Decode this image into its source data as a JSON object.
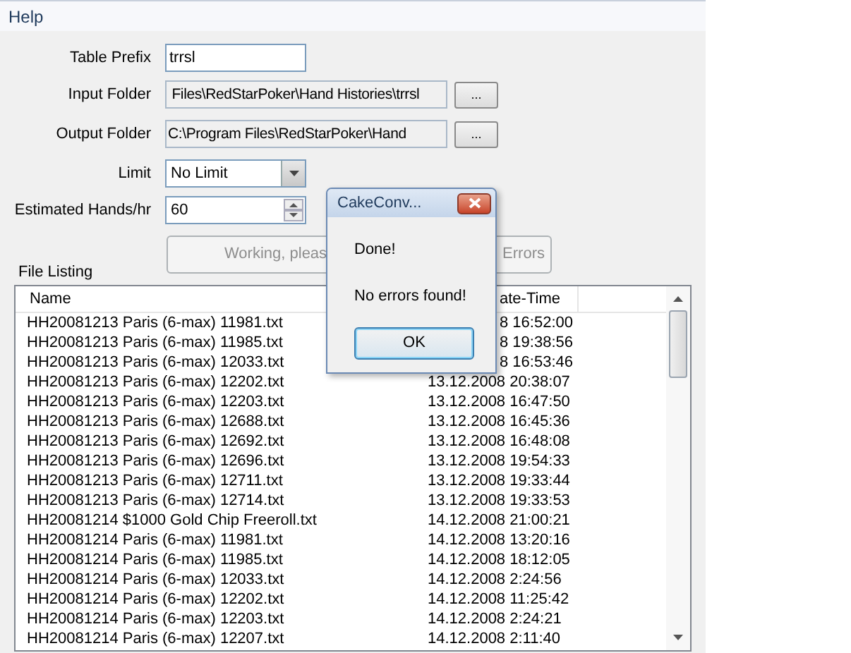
{
  "menu": [
    "Help"
  ],
  "form": {
    "table_prefix": {
      "label": "Table Prefix",
      "value": "trrsl"
    },
    "input_folder": {
      "label": "Input Folder",
      "value": " Files\\RedStarPoker\\Hand Histories\\trrsl",
      "browse": "..."
    },
    "output_folder": {
      "label": "Output Folder",
      "value": "C:\\Program Files\\RedStarPoker\\Hand",
      "browse": "..."
    },
    "limit": {
      "label": "Limit",
      "value": "No Limit"
    },
    "hands_per_hour": {
      "label": "Estimated Hands/hr",
      "value": "60"
    }
  },
  "action_button": {
    "label_left": "Working, pleas",
    "label_right": "Errors",
    "disabled": true
  },
  "file_listing": {
    "label": "File Listing",
    "columns": [
      {
        "label": "Name"
      },
      {
        "label": "ate-Time",
        "clipped": true
      }
    ],
    "rows": [
      {
        "name": "HH20081213 Paris (6-max) 11981.txt",
        "date": "8 16:52:00",
        "clipped": true
      },
      {
        "name": "HH20081213 Paris (6-max) 11985.txt",
        "date": "8 19:38:56",
        "clipped": true
      },
      {
        "name": "HH20081213 Paris (6-max) 12033.txt",
        "date": "8 16:53:46",
        "clipped": true
      },
      {
        "name": "HH20081213 Paris (6-max) 12202.txt",
        "date": "13.12.2008 20:38:07"
      },
      {
        "name": "HH20081213 Paris (6-max) 12203.txt",
        "date": "13.12.2008 16:47:50"
      },
      {
        "name": "HH20081213 Paris (6-max) 12688.txt",
        "date": "13.12.2008 16:45:36"
      },
      {
        "name": "HH20081213 Paris (6-max) 12692.txt",
        "date": "13.12.2008 16:48:08"
      },
      {
        "name": "HH20081213 Paris (6-max) 12696.txt",
        "date": "13.12.2008 19:54:33"
      },
      {
        "name": "HH20081213 Paris (6-max) 12711.txt",
        "date": "13.12.2008 19:33:44"
      },
      {
        "name": "HH20081213 Paris (6-max) 12714.txt",
        "date": "13.12.2008 19:33:53"
      },
      {
        "name": "HH20081214 $1000 Gold Chip Freeroll.txt",
        "date": "14.12.2008 21:00:21"
      },
      {
        "name": "HH20081214 Paris (6-max) 11981.txt",
        "date": "14.12.2008 13:20:16"
      },
      {
        "name": "HH20081214 Paris (6-max) 11985.txt",
        "date": "14.12.2008 18:12:05"
      },
      {
        "name": "HH20081214 Paris (6-max) 12033.txt",
        "date": "14.12.2008 2:24:56"
      },
      {
        "name": "HH20081214 Paris (6-max) 12202.txt",
        "date": "14.12.2008 11:25:42"
      },
      {
        "name": "HH20081214 Paris (6-max) 12203.txt",
        "date": "14.12.2008 2:24:21"
      },
      {
        "name": "HH20081214 Paris (6-max) 12207.txt",
        "date": "14.12.2008 2:11:40"
      }
    ]
  },
  "dialog": {
    "title": "CakeConv...",
    "lines": [
      "Done!",
      "No errors found!"
    ],
    "button": "OK"
  }
}
